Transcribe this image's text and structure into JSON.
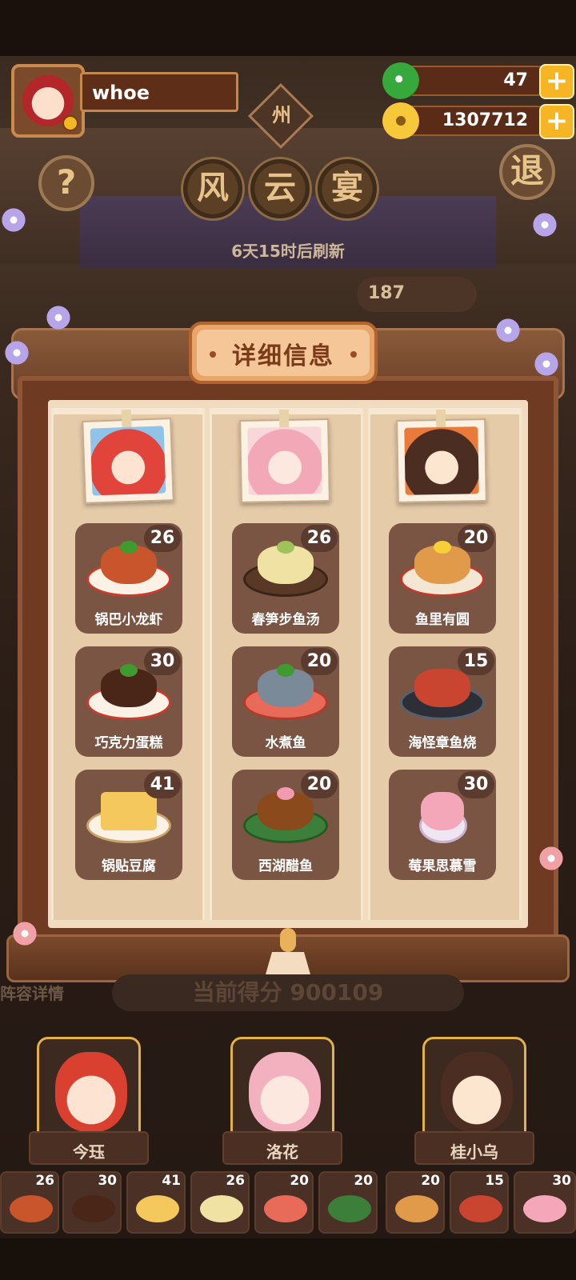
{
  "player": {
    "name": "whoe"
  },
  "currency": {
    "gems": "47",
    "coins": "1307712"
  },
  "region_tag": "州",
  "title_chars": [
    "风",
    "云",
    "宴"
  ],
  "help_label": "?",
  "exit_label": "退",
  "refresh_text": "6天15时后刷新",
  "score_partial": "187",
  "dialog": {
    "title": "详细信息",
    "columns": [
      {
        "character": "今珏",
        "dishes": [
          {
            "name": "锅巴小龙虾",
            "count": "26"
          },
          {
            "name": "巧克力蛋糕",
            "count": "30"
          },
          {
            "name": "锅贴豆腐",
            "count": "41"
          }
        ]
      },
      {
        "character": "洛花",
        "dishes": [
          {
            "name": "春笋步鱼汤",
            "count": "26"
          },
          {
            "name": "水煮鱼",
            "count": "20"
          },
          {
            "name": "西湖醋鱼",
            "count": "20"
          }
        ]
      },
      {
        "character": "桂小乌",
        "dishes": [
          {
            "name": "鱼里有圆",
            "count": "20"
          },
          {
            "name": "海怪章鱼烧",
            "count": "15"
          },
          {
            "name": "莓果思慕雪",
            "count": "30"
          }
        ]
      }
    ]
  },
  "under": {
    "lineup_label": "阵容详情",
    "current_score": "当前得分 900109"
  },
  "characters": [
    "今珏",
    "洛花",
    "桂小乌"
  ],
  "mini_counts": [
    "26",
    "30",
    "41",
    "26",
    "20",
    "20",
    "20",
    "15",
    "30"
  ],
  "colors": {
    "accent": "#f5b524",
    "scroll": "#6e3a22",
    "paper": "#f1dcc0",
    "card": "#7a5543"
  }
}
